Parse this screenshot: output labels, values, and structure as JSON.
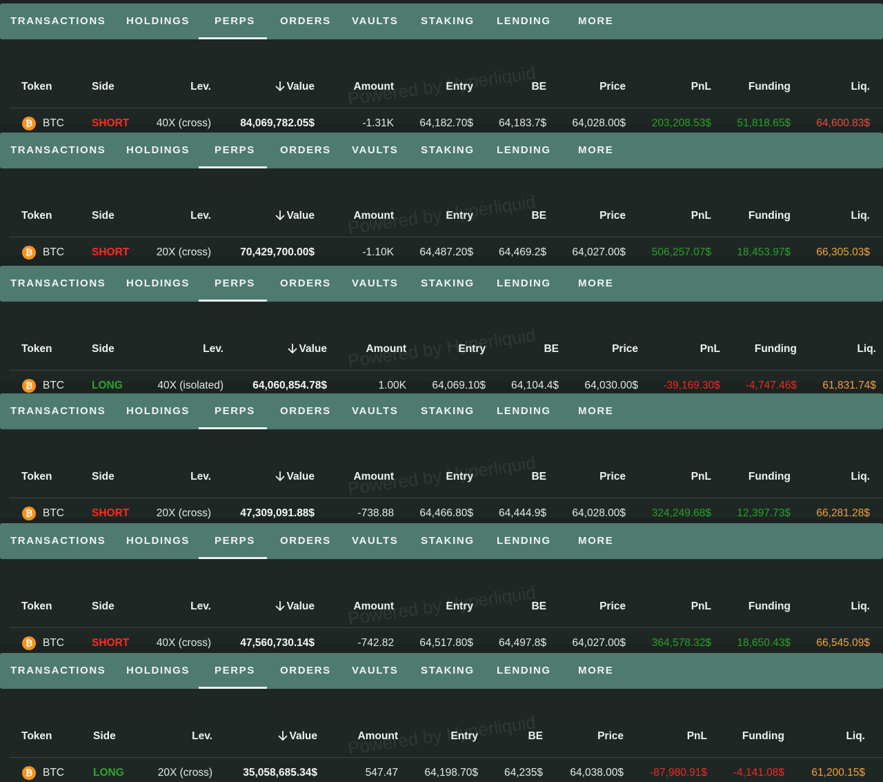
{
  "tabs": [
    "TRANSACTIONS",
    "HOLDINGS",
    "PERPS",
    "ORDERS",
    "VAULTS",
    "STAKING",
    "LENDING",
    "MORE"
  ],
  "active_tab": "PERPS",
  "columns": {
    "token": "Token",
    "side": "Side",
    "lev": "Lev.",
    "value": "Value",
    "amount": "Amount",
    "entry": "Entry",
    "be": "BE",
    "price": "Price",
    "pnl": "PnL",
    "funding": "Funding",
    "liq": "Liq."
  },
  "watermark": "Powered by Hyperliquid",
  "colors": {
    "tab_bar": "#4e7a70",
    "background": "#1f2725",
    "short": "#ff2a1f",
    "long": "#2fa42f",
    "profit": "#26a326",
    "loss": "#ef2a22",
    "liq": "#f3a13a",
    "liq_risk": "#ef4a42",
    "btc": "#f7931a"
  },
  "panels": [
    {
      "token": "BTC",
      "token_icon": "bitcoin-icon",
      "side": "SHORT",
      "lev": "40X (cross)",
      "value": "84,069,782.05$",
      "amount": "-1.31K",
      "entry": "64,182.70$",
      "be": "64,183.7$",
      "price": "64,028.00$",
      "pnl": "203,208.53$",
      "funding": "51,818.65$",
      "liq": "64,600.83$"
    },
    {
      "token": "BTC",
      "token_icon": "bitcoin-icon",
      "side": "SHORT",
      "lev": "20X (cross)",
      "value": "70,429,700.00$",
      "amount": "-1.10K",
      "entry": "64,487.20$",
      "be": "64,469.2$",
      "price": "64,027.00$",
      "pnl": "506,257.07$",
      "funding": "18,453.97$",
      "liq": "66,305.03$"
    },
    {
      "token": "BTC",
      "token_icon": "bitcoin-icon",
      "side": "LONG",
      "lev": "40X (isolated)",
      "value": "64,060,854.78$",
      "amount": "1.00K",
      "entry": "64,069.10$",
      "be": "64,104.4$",
      "price": "64,030.00$",
      "pnl": "-39,169.30$",
      "funding": "-4,747.46$",
      "liq": "61,831.74$"
    },
    {
      "token": "BTC",
      "token_icon": "bitcoin-icon",
      "side": "SHORT",
      "lev": "20X (cross)",
      "value": "47,309,091.88$",
      "amount": "-738.88",
      "entry": "64,466.80$",
      "be": "64,444.9$",
      "price": "64,028.00$",
      "pnl": "324,249.68$",
      "funding": "12,397.73$",
      "liq": "66,281.28$"
    },
    {
      "token": "BTC",
      "token_icon": "bitcoin-icon",
      "side": "SHORT",
      "lev": "40X (cross)",
      "value": "47,560,730.14$",
      "amount": "-742.82",
      "entry": "64,517.80$",
      "be": "64,497.8$",
      "price": "64,027.00$",
      "pnl": "364,578.32$",
      "funding": "18,650.43$",
      "liq": "66,545.09$"
    },
    {
      "token": "BTC",
      "token_icon": "bitcoin-icon",
      "side": "LONG",
      "lev": "20X (cross)",
      "value": "35,058,685.34$",
      "amount": "547.47",
      "entry": "64,198.70$",
      "be": "64,235$",
      "price": "64,038.00$",
      "pnl": "-87,980.91$",
      "funding": "-4,141.08$",
      "liq": "61,200.15$"
    }
  ]
}
